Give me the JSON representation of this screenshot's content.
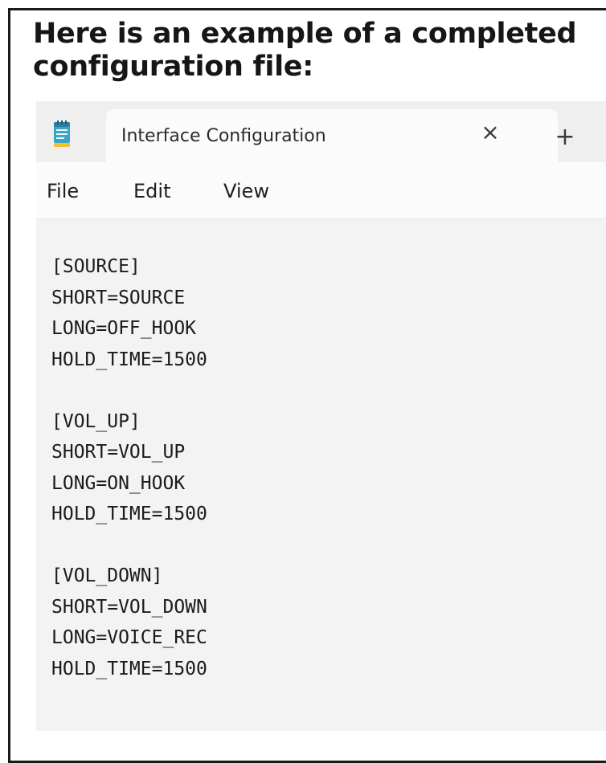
{
  "heading": "Here is an example of a completed configuration file:",
  "window": {
    "app_icon": "notepad-icon",
    "tab": {
      "title": "Interface Configuration",
      "close_glyph": "×",
      "close_icon": "close-icon"
    },
    "new_tab": {
      "glyph": "+",
      "icon": "plus-icon"
    },
    "menu": {
      "file": "File",
      "edit": "Edit",
      "view": "View"
    },
    "editor": {
      "content": "[SOURCE]\nSHORT=SOURCE\nLONG=OFF_HOOK\nHOLD_TIME=1500\n\n[VOL_UP]\nSHORT=VOL_UP\nLONG=ON_HOOK\nHOLD_TIME=1500\n\n[VOL_DOWN]\nSHORT=VOL_DOWN\nLONG=VOICE_REC\nHOLD_TIME=1500"
    }
  },
  "colors": {
    "border": "#1a1a1a",
    "tabstrip": "#efefef",
    "active_tab": "#fbfbfb",
    "editor_background": "#f3f3f3",
    "notepad_icon_teal": "#3aa6c4",
    "notepad_icon_yellow": "#f1c232"
  }
}
